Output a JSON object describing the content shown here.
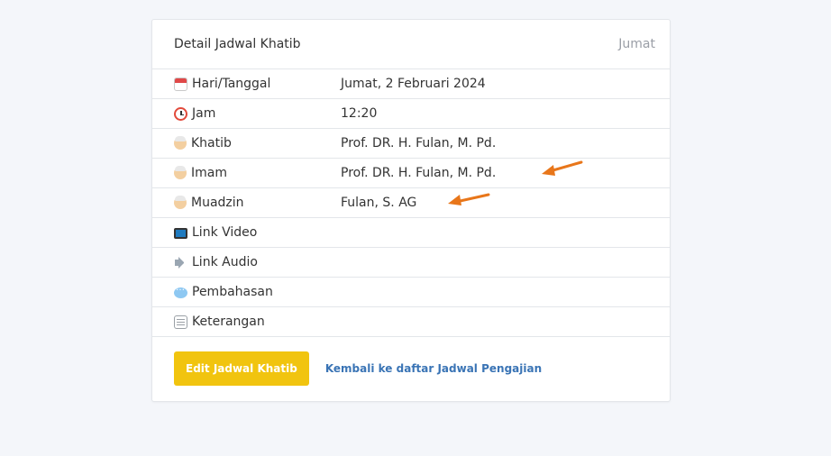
{
  "header": {
    "title": "Detail Jadwal Khatib",
    "day": "Jumat"
  },
  "rows": [
    {
      "icon": "calendar-icon",
      "label": "Hari/Tanggal",
      "value": "Jumat, 2 Februari 2024"
    },
    {
      "icon": "alarm-clock-icon",
      "label": "Jam",
      "value": "12:20"
    },
    {
      "icon": "person-icon",
      "label": "Khatib",
      "value": "Prof. DR. H. Fulan, M. Pd."
    },
    {
      "icon": "person-icon",
      "label": "Imam",
      "value": "Prof. DR. H. Fulan, M. Pd."
    },
    {
      "icon": "person-icon",
      "label": "Muadzin",
      "value": "Fulan, S. AG"
    },
    {
      "icon": "tv-icon",
      "label": "Link Video",
      "value": ""
    },
    {
      "icon": "speaker-icon",
      "label": "Link Audio",
      "value": ""
    },
    {
      "icon": "speech-bubble-icon",
      "label": "Pembahasan",
      "value": ""
    },
    {
      "icon": "notepad-icon",
      "label": "Keterangan",
      "value": ""
    }
  ],
  "footer": {
    "edit_label": "Edit Jadwal Khatib",
    "back_label": "Kembali ke daftar Jadwal Pengajian"
  },
  "colors": {
    "accent_button": "#f1c40f",
    "link": "#3a74b5",
    "annotation_arrow": "#e8761a",
    "background": "#f4f6fa"
  }
}
